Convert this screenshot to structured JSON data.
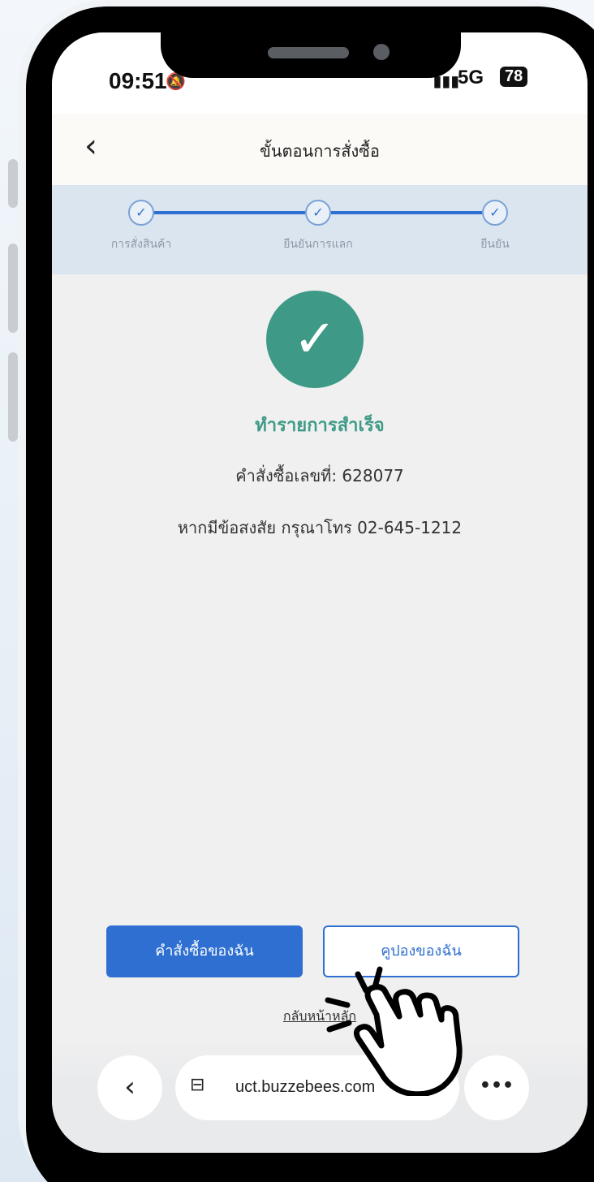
{
  "status_bar": {
    "time": "09:51",
    "network": "5G",
    "battery": "78"
  },
  "header": {
    "back_icon": "chevron-left-icon",
    "title": "ขั้นตอนการสั่งซื้อ"
  },
  "stepper": {
    "steps": [
      {
        "label": "การสั่งสินค้า",
        "done": true
      },
      {
        "label": "ยืนยันการแลก",
        "done": true
      },
      {
        "label": "ยืนยัน",
        "done": true
      }
    ],
    "check_glyph": "✓"
  },
  "result": {
    "check_glyph": "✓",
    "title": "ทำรายการสำเร็จ",
    "order_label": "คำสั่งซื้อเลขที่: 628077",
    "contact": "หากมีข้อสงสัย กรุณาโทร 02-645-1212"
  },
  "actions": {
    "my_orders": "คำสั่งซื้อของฉัน",
    "my_coupons": "คูปองของฉัน",
    "back_home": "กลับหน้าหลัก"
  },
  "browser": {
    "back_glyph": "‹",
    "url": "uct.buzzebees.com",
    "reload_glyph": "↻",
    "more_glyph": "•••",
    "tab_glyph": "⊟"
  },
  "colors": {
    "primary": "#2e6fd1",
    "success": "#3e9a86"
  },
  "overlay": {
    "icon": "tap-hand-icon"
  }
}
